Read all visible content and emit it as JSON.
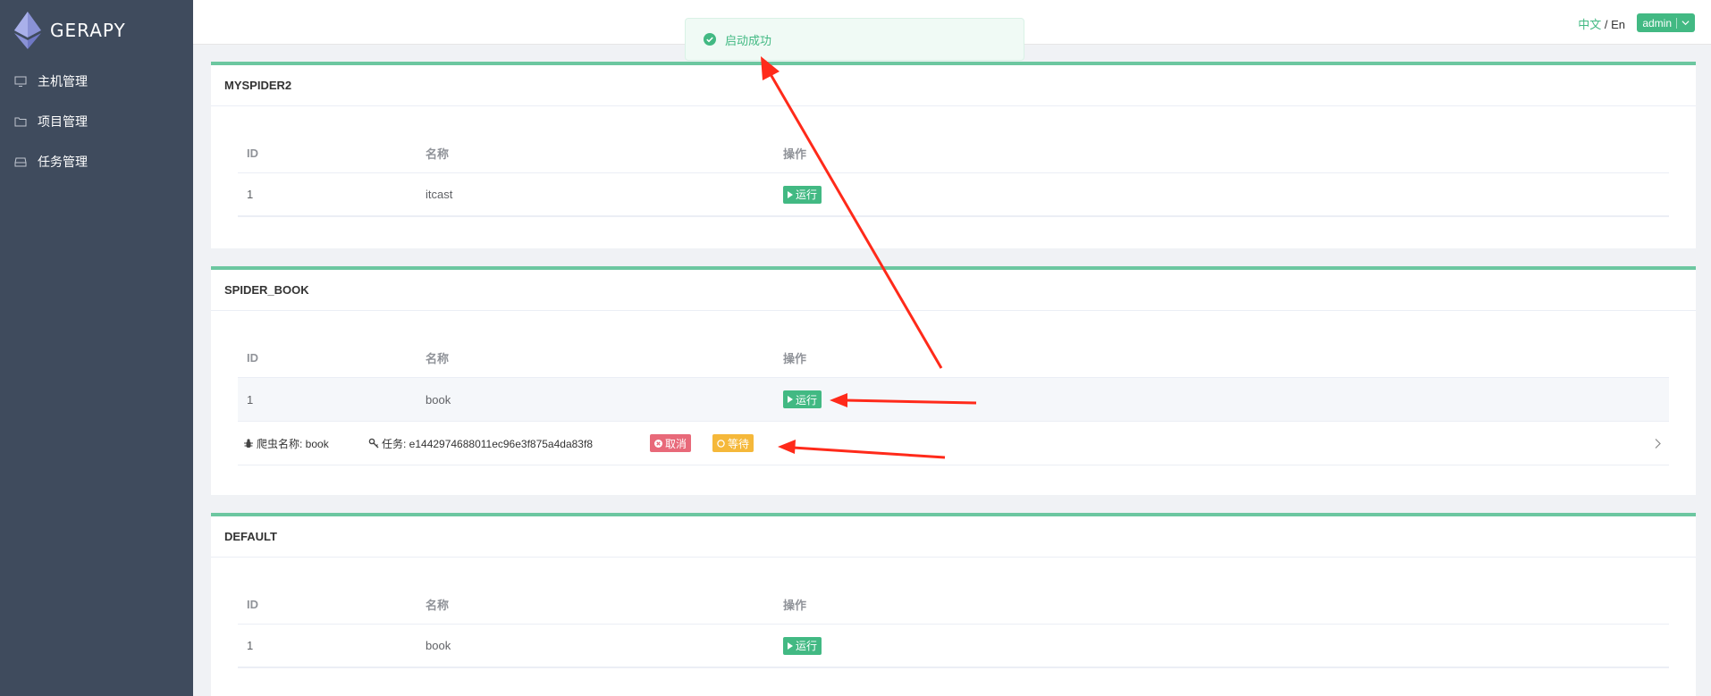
{
  "app": {
    "title": "GERAPY"
  },
  "sidebar": {
    "items": [
      {
        "label": "主机管理",
        "icon": "monitor-icon"
      },
      {
        "label": "项目管理",
        "icon": "folder-icon"
      },
      {
        "label": "任务管理",
        "icon": "inbox-icon"
      }
    ]
  },
  "header": {
    "lang_zh": "中文",
    "lang_sep": "/",
    "lang_en": "En",
    "user": "admin"
  },
  "toast": {
    "message": "启动成功",
    "icon": "check-circle-icon"
  },
  "columns": {
    "id": "ID",
    "name": "名称",
    "op": "操作"
  },
  "run_label": "运行",
  "projects": [
    {
      "title": "MYSPIDER2",
      "rows": [
        {
          "id": "1",
          "name": "itcast"
        }
      ]
    },
    {
      "title": "SPIDER_BOOK",
      "rows": [
        {
          "id": "1",
          "name": "book"
        }
      ],
      "job": {
        "spider_label": "爬虫名称: book",
        "task_label": "任务: e1442974688011ec96e3f875a4da83f8",
        "cancel_label": "取消",
        "status_label": "等待"
      }
    },
    {
      "title": "DEFAULT",
      "rows": [
        {
          "id": "1",
          "name": "book"
        }
      ]
    }
  ],
  "colors": {
    "accent": "#42b983",
    "sidebar": "#3f4b5d",
    "danger": "#e86979",
    "warning": "#f5b83a",
    "annotation": "#ff2a1a"
  }
}
